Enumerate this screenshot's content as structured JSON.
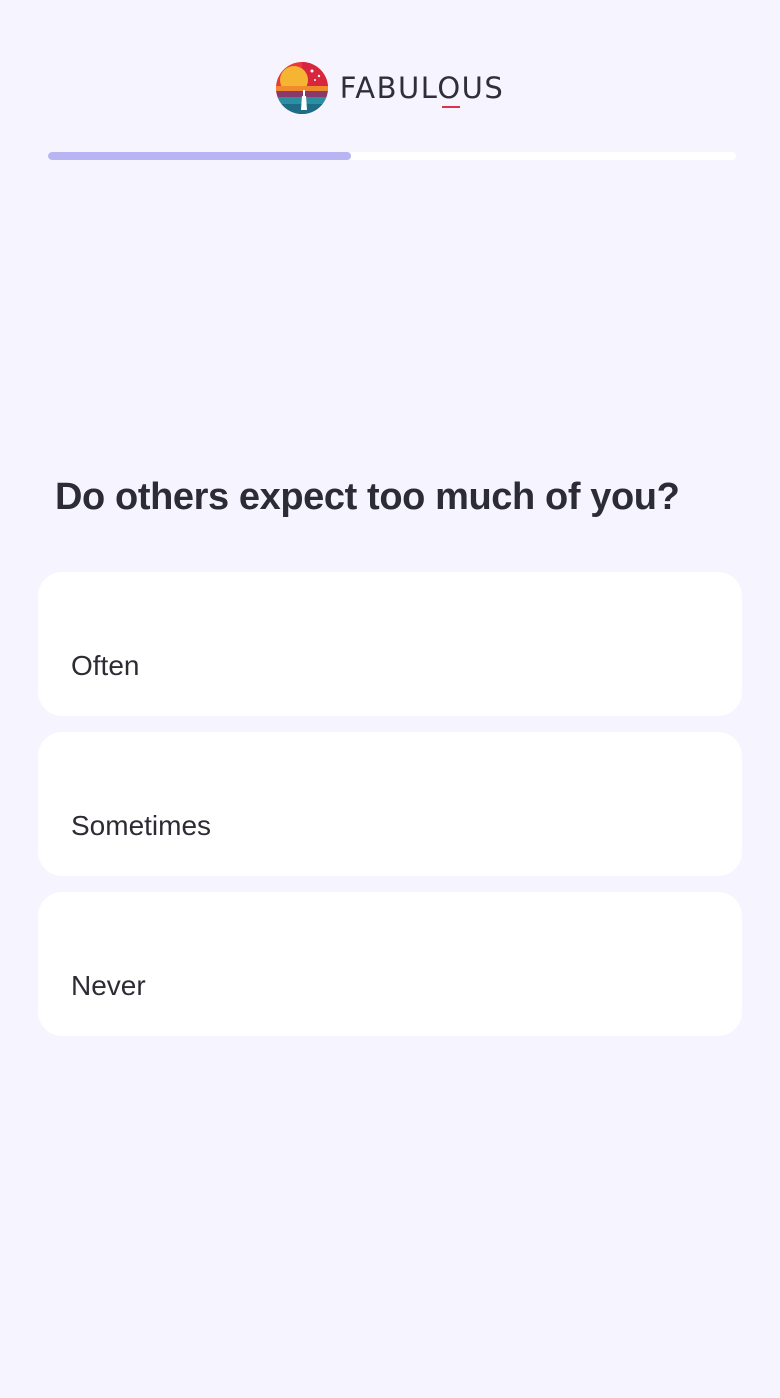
{
  "brand": {
    "name": "FABULOUS",
    "logo_icon": "fabulous-sunset-logo-icon",
    "accent_color": "#e0314b"
  },
  "progress": {
    "fraction": 0.44,
    "fill_color": "#b9b4f4",
    "track_color": "#ffffff"
  },
  "quiz": {
    "question": "Do others expect too much of you?",
    "options": [
      {
        "label": "Often"
      },
      {
        "label": "Sometimes"
      },
      {
        "label": "Never"
      }
    ]
  },
  "colors": {
    "background": "#f6f5ff",
    "card": "#ffffff",
    "text": "#2c2c34"
  }
}
